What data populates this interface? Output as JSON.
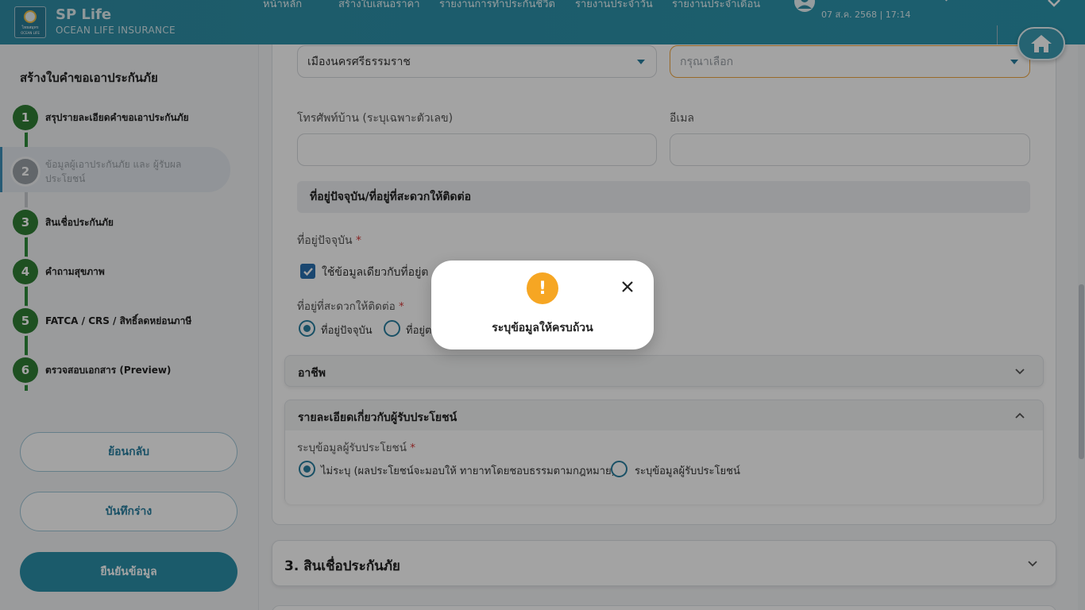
{
  "header": {
    "logo_text": "ไทยสมุทร",
    "logo_sub": "OCEAN LIFE",
    "brand_title": "SP Life",
    "brand_subtitle": "OCEAN LIFE INSURANCE",
    "nav": [
      "หน้าหลัก",
      "สร้างใบเสนอราคา",
      "รายงานการทำประกันชีวิต",
      "รายงานประจำวัน",
      "รายงานประจำเดือน"
    ],
    "datetime": "07 ส.ค. 2568 | 17:14"
  },
  "sidebar": {
    "title": "สร้างใบคำขอเอาประกันภัย",
    "steps": [
      {
        "num": "1",
        "label": "สรุปรายละเอียดคำขอเอาประกันภัย"
      },
      {
        "num": "2",
        "label": "ข้อมูลผู้เอาประกันภัย และ ผู้รับผลประโยชน์"
      },
      {
        "num": "3",
        "label": "สินเชื่อประกันภัย"
      },
      {
        "num": "4",
        "label": "คำถามสุขภาพ"
      },
      {
        "num": "5",
        "label": "FATCA / CRS / สิทธิ์ลดหย่อนภาษี"
      },
      {
        "num": "6",
        "label": "ตรวจสอบเอกสาร (Preview)"
      }
    ],
    "back_label": "ย้อนกลับ",
    "draft_label": "บันทึกร่าง",
    "confirm_label": "ยืนยันข้อมูล"
  },
  "form": {
    "district_value": "เมืองนครศรีธรรมราช",
    "subdistrict_placeholder": "กรุณาเลือก",
    "phone_label": "โทรศัพท์บ้าน (ระบุเฉพาะตัวเลข)",
    "email_label": "อีเมล",
    "section_address": "ที่อยู่ปัจจุบัน/ที่อยู่ที่สะดวกให้ติดต่อ",
    "current_address_label": "ที่อยู่ปัจจุบัน",
    "same_address_checkbox": "ใช้ข้อมูลเดียวกับที่อยู่ต",
    "contact_address_label": "ที่อยู่ที่สะดวกให้ติดต่อ",
    "radio_current": "ที่อยู่ปัจจุบัน",
    "radio_other": "ที่อยู่ต",
    "required_mark": "*"
  },
  "accordions": {
    "occupation": "อาชีพ",
    "beneficiary": "รายละเอียดเกี่ยวกับผู้รับประโยชน์",
    "beneficiary_label": "ระบุข้อมูลผู้รับประโยชน์",
    "ben_radio_none": "ไม่ระบุ (ผลประโยชน์จะมอบให้ ทายาทโดยชอบธรรมตามกฎหมาย)",
    "ben_radio_specify": "ระบุข้อมูลผู้รับประโยชน์",
    "section3": "3. สินเชื่อประกันภัย"
  },
  "modal": {
    "icon": "!",
    "message": "ระบุข้อมูลให้ครบถ้วน"
  },
  "colors": {
    "header": "#2f8ea6",
    "step_done": "#2f7d35",
    "accent": "#2a7fa0",
    "warning": "#f6a623"
  },
  "icons": [
    "user-icon",
    "search-icon",
    "chevron-down-icon",
    "home-icon",
    "caret-down-icon",
    "checkmark-icon",
    "chevron-up-icon",
    "warning-icon",
    "close-icon"
  ]
}
